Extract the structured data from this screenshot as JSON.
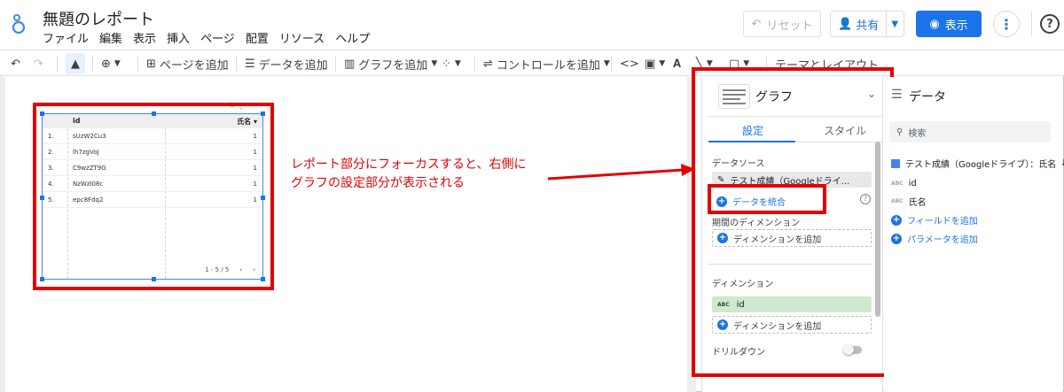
{
  "header": {
    "title": "無題のレポート",
    "menu": [
      "ファイル",
      "編集",
      "表示",
      "挿入",
      "ページ",
      "配置",
      "リソース",
      "ヘルプ"
    ],
    "reset_label": "リセット",
    "share_label": "共有",
    "view_label": "表示",
    "help_label": "?"
  },
  "toolbar": {
    "add_page": "ページを追加",
    "add_data": "データを追加",
    "add_chart": "グラフを追加",
    "add_control": "コントロールを追加",
    "theme_layout": "テーマとレイアウト"
  },
  "table": {
    "header_id": "id",
    "header_name": "氏名 ▾",
    "rows": [
      {
        "n": "1.",
        "id": "sUzW2Cu3",
        "v": "1"
      },
      {
        "n": "2.",
        "id": "lh7zgVoJ",
        "v": "1"
      },
      {
        "n": "3.",
        "id": "C9wzZT9G",
        "v": "1"
      },
      {
        "n": "4.",
        "id": "NzWzl08c",
        "v": "1"
      },
      {
        "n": "5.",
        "id": "epc8Fdq2",
        "v": "1"
      }
    ],
    "pager": "1 - 5 / 5"
  },
  "annotation": {
    "line1": "レポート部分にフォーカスすると、右側に",
    "line2": "グラフの設定部分が表示される",
    "color": "#e50000"
  },
  "properties": {
    "title": "グラフ",
    "tab_setup": "設定",
    "tab_style": "スタイル",
    "datasource_label": "データソース",
    "datasource_name": "テスト成績（Googleドライ...",
    "blend_label": "データを統合",
    "period_dimension_label": "期間のディメンション",
    "add_dimension": "ディメンションを追加",
    "dimension_label": "ディメンション",
    "dimension_value": "id",
    "add_dimension2": "ディメンションを追加",
    "drilldown_label": "ドリルダウン"
  },
  "data_panel": {
    "title": "データ",
    "search_placeholder": "検索",
    "source": "テスト成績（Googleドライブ）：氏名",
    "fields": [
      "id",
      "氏名"
    ],
    "add_field": "フィールドを追加",
    "add_parameter": "パラメータを追加"
  },
  "colors": {
    "accent": "#1a73e8",
    "annotation": "#e50000",
    "dimension_chip": "#cfe9cf"
  }
}
